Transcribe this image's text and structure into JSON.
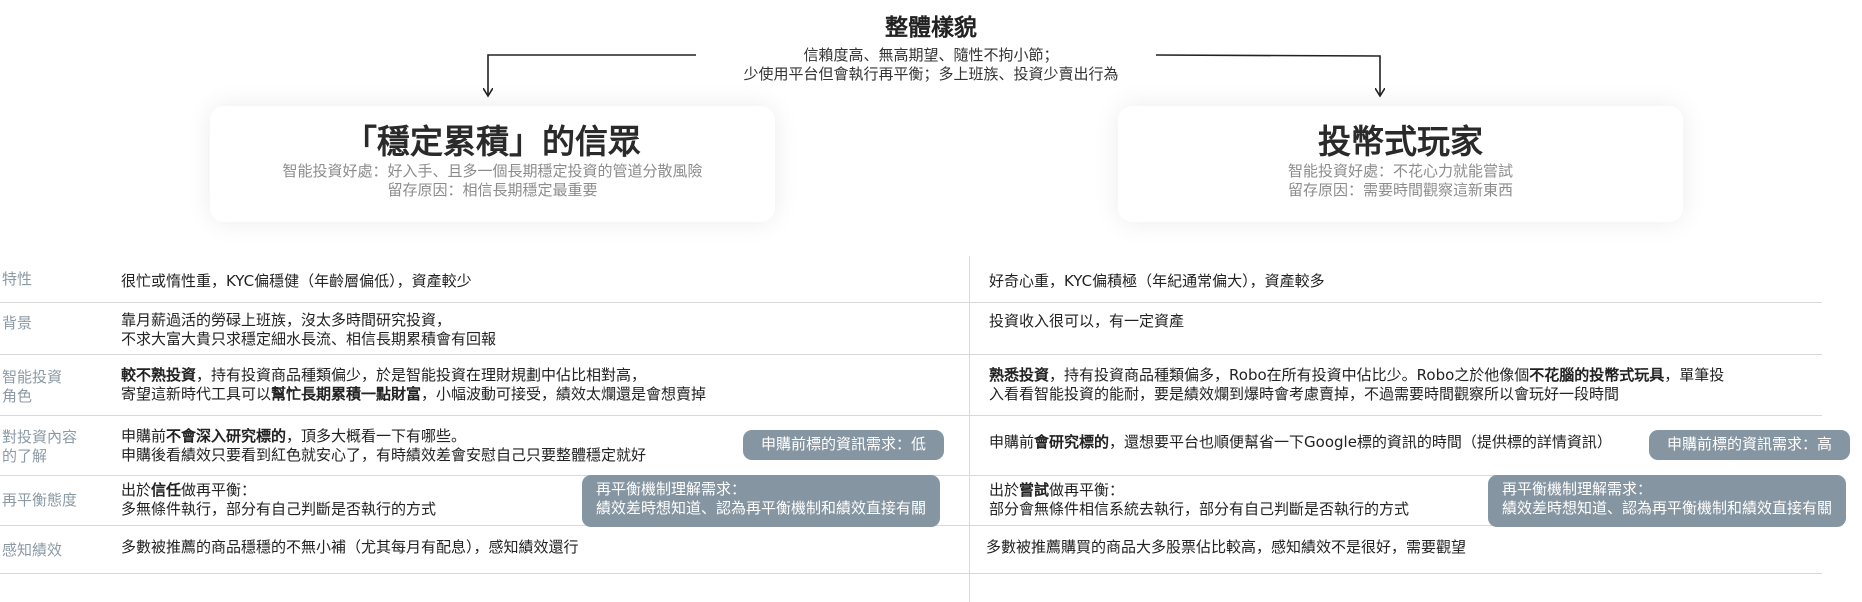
{
  "header": {
    "title": "整體樣貌",
    "subtitle_line1": "信賴度高、無高期望、隨性不拘小節；",
    "subtitle_line2": "少使用平台但會執行再平衡；多上班族、投資少賣出行為"
  },
  "personas": [
    {
      "title": "「穩定累積」的信眾",
      "benefit": "智能投資好處：好入手、且多一個長期穩定投資的管道分散風險",
      "retention": "留存原因：相信長期穩定最重要"
    },
    {
      "title": "投幣式玩家",
      "benefit": "智能投資好處：不花心力就能嘗試",
      "retention": "留存原因：需要時間觀察這新東西"
    }
  ],
  "rows": {
    "traits": {
      "label": "特性",
      "left": "很忙或惰性重，KYC偏穩健（年齡層偏低），資產較少",
      "right": "好奇心重，KYC偏積極（年紀通常偏大），資產較多"
    },
    "background": {
      "label": "背景",
      "left_line1": "靠月薪過活的勞碌上班族，沒太多時間研究投資，",
      "left_line2": "不求大富大貴只求穩定細水長流、相信長期累積會有回報",
      "right": "投資收入很可以，有一定資產"
    },
    "role": {
      "label_line1": "智能投資",
      "label_line2": "角色",
      "left_l1_bold": "較不熟投資",
      "left_l1_rest": "，持有投資商品種類偏少，於是智能投資在理財規劃中佔比相對高，",
      "left_l2_pre": "寄望這新時代工具可以",
      "left_l2_bold": "幫忙長期累積一點財富",
      "left_l2_post": "，小幅波動可接受，績效太爛還是會想賣掉",
      "right_l1_bold": "熟悉投資",
      "right_l1_mid": "，持有投資商品種類偏多，Robo在所有投資中佔比少。Robo之於他像個",
      "right_l1_bold2": "不花腦的投幣式玩具",
      "right_l1_post": "，單筆投",
      "right_l2": "入看看智能投資的能耐，要是績效爛到爆時會考慮賣掉，不過需要時間觀察所以會玩好一段時間"
    },
    "understanding": {
      "label_line1": "對投資內容",
      "label_line2": "的了解",
      "left_l1_pre": "申購前",
      "left_l1_bold": "不會深入研究標的",
      "left_l1_post": "，頂多大概看一下有哪些。",
      "left_l2": "申購後看績效只要看到紅色就安心了，有時績效差會安慰自己只要整體穩定就好",
      "left_pill": "申購前標的資訊需求：低",
      "right_pre": "申購前",
      "right_bold": "會研究標的",
      "right_post": "，還想要平台也順便幫省一下Google標的資訊的時間（提供標的詳情資訊）",
      "right_pill": "申購前標的資訊需求：高"
    },
    "rebalance": {
      "label": "再平衡態度",
      "left_l1_pre": "出於",
      "left_l1_bold": "信任",
      "left_l1_post": "做再平衡：",
      "left_l2": "多無條件執行，部分有自己判斷是否執行的方式",
      "left_pill_l1": "再平衡機制理解需求：",
      "left_pill_l2": "績效差時想知道、認為再平衡機制和績效直接有關",
      "right_l1_pre": "出於",
      "right_l1_bold": "嘗試",
      "right_l1_post": "做再平衡：",
      "right_l2": "部分會無條件相信系統去執行，部分有自己判斷是否執行的方式",
      "right_pill_l1": "再平衡機制理解需求：",
      "right_pill_l2": "績效差時想知道、認為再平衡機制和績效直接有關"
    },
    "performance": {
      "label": "感知績效",
      "left": "多數被推薦的商品穩穩的不無小補（尤其每月有配息），感知績效還行",
      "right": "多數被推薦購買的商品大多股票佔比較高，感知績效不是很好，需要觀望"
    }
  }
}
